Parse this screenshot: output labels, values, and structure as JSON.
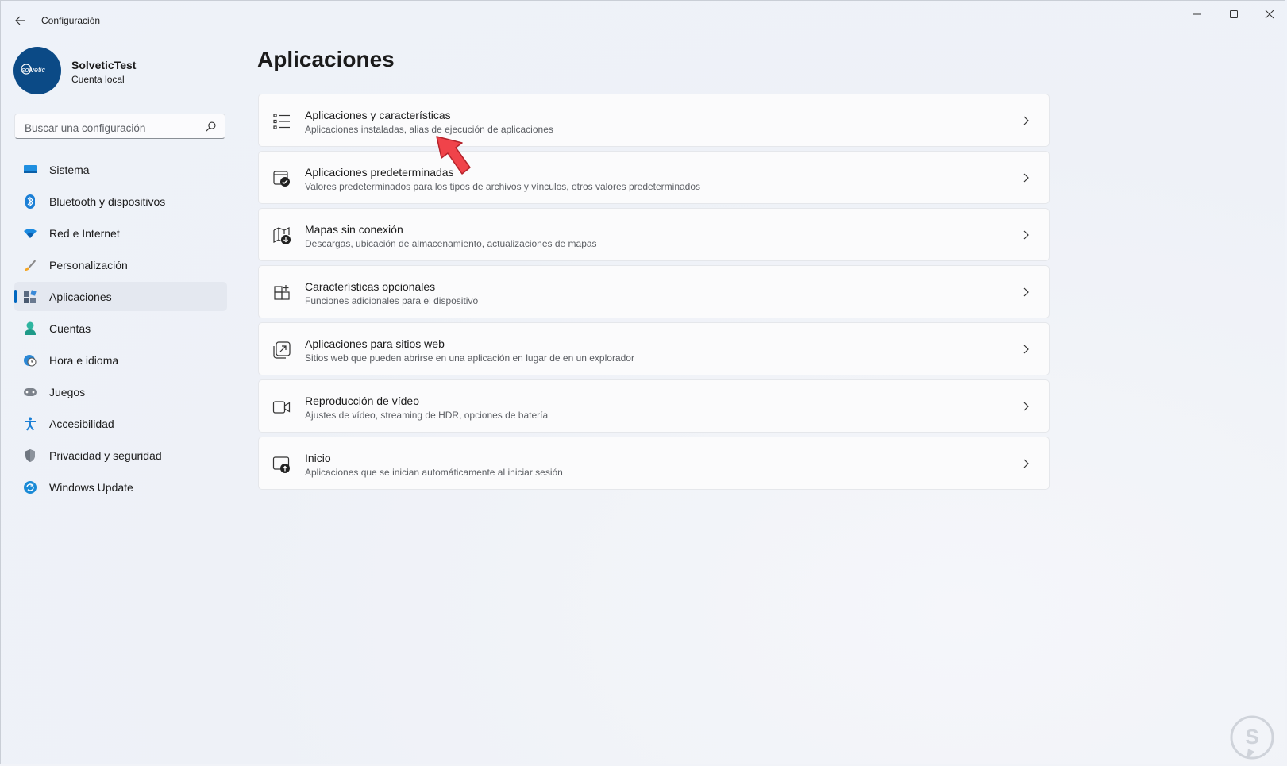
{
  "window": {
    "title": "Configuración",
    "controls": [
      "minimize-icon",
      "maximize-icon",
      "close-icon"
    ]
  },
  "profile": {
    "name": "SolveticTest",
    "account_type": "Cuenta local",
    "avatar_text": "solvetic"
  },
  "search": {
    "placeholder": "Buscar una configuración",
    "value": ""
  },
  "sidebar": {
    "items": [
      {
        "label": "Sistema",
        "icon": "system-icon",
        "selected": false
      },
      {
        "label": "Bluetooth y dispositivos",
        "icon": "bluetooth-icon",
        "selected": false
      },
      {
        "label": "Red e Internet",
        "icon": "wifi-icon",
        "selected": false
      },
      {
        "label": "Personalización",
        "icon": "brush-icon",
        "selected": false
      },
      {
        "label": "Aplicaciones",
        "icon": "apps-icon",
        "selected": true
      },
      {
        "label": "Cuentas",
        "icon": "person-icon",
        "selected": false
      },
      {
        "label": "Hora e idioma",
        "icon": "clock-globe-icon",
        "selected": false
      },
      {
        "label": "Juegos",
        "icon": "gamepad-icon",
        "selected": false
      },
      {
        "label": "Accesibilidad",
        "icon": "accessibility-icon",
        "selected": false
      },
      {
        "label": "Privacidad y seguridad",
        "icon": "shield-icon",
        "selected": false
      },
      {
        "label": "Windows Update",
        "icon": "update-icon",
        "selected": false
      }
    ]
  },
  "main": {
    "title": "Aplicaciones",
    "cards": [
      {
        "title": "Aplicaciones y características",
        "subtitle": "Aplicaciones instaladas, alias de ejecución de aplicaciones",
        "icon": "list-icon"
      },
      {
        "title": "Aplicaciones predeterminadas",
        "subtitle": "Valores predeterminados para los tipos de archivos y vínculos, otros valores predeterminados",
        "icon": "default-apps-icon"
      },
      {
        "title": "Mapas sin conexión",
        "subtitle": "Descargas, ubicación de almacenamiento, actualizaciones de mapas",
        "icon": "map-download-icon"
      },
      {
        "title": "Características opcionales",
        "subtitle": "Funciones adicionales para el dispositivo",
        "icon": "add-grid-icon"
      },
      {
        "title": "Aplicaciones para sitios web",
        "subtitle": "Sitios web que pueden abrirse en una aplicación en lugar de en un explorador",
        "icon": "open-external-icon"
      },
      {
        "title": "Reproducción de vídeo",
        "subtitle": "Ajustes de vídeo, streaming de HDR, opciones de batería",
        "icon": "video-camera-icon"
      },
      {
        "title": "Inicio",
        "subtitle": "Aplicaciones que se inician automáticamente al iniciar sesión",
        "icon": "startup-icon"
      }
    ]
  },
  "colors": {
    "accent": "#0067c0",
    "arrow": "#f0434a",
    "avatar_bg": "#0b4a86"
  }
}
